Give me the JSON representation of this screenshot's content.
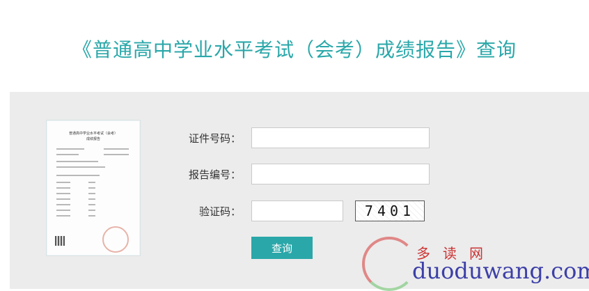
{
  "page": {
    "title": "《普通高中学业水平考试（会考）成绩报告》查询"
  },
  "certificate": {
    "title_line1": "普通高中学业水平考试（会考）",
    "title_line2": "成绩报告"
  },
  "form": {
    "id_label": "证件号码：",
    "id_value": "",
    "report_label": "报告编号：",
    "report_value": "",
    "captcha_label": "验证码：",
    "captcha_value": "",
    "captcha_code": "7401",
    "submit_label": "查询"
  },
  "watermark": {
    "cn_text": "多读网",
    "url_text": "duoduwang.com"
  },
  "colors": {
    "accent": "#2aa7a9",
    "panel_bg": "#ececec"
  }
}
